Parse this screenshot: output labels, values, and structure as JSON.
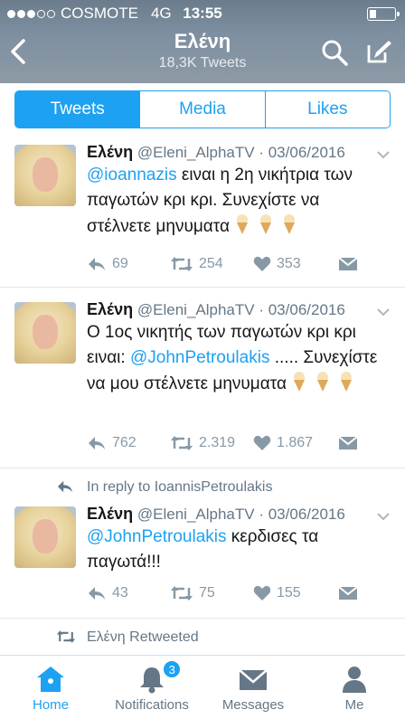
{
  "status_bar": {
    "carrier": "COSMOTE",
    "network": "4G",
    "time": "13:55",
    "signal_dots_filled": 3,
    "signal_dots_total": 5,
    "battery_level": 0.2
  },
  "header": {
    "title": "Ελένη",
    "subtitle": "18,3K Tweets",
    "back_icon": "chevron-left-icon",
    "search_icon": "search-icon",
    "compose_icon": "compose-icon"
  },
  "tabs": {
    "items": [
      {
        "label": "Tweets",
        "active": true
      },
      {
        "label": "Media",
        "active": false
      },
      {
        "label": "Likes",
        "active": false
      }
    ]
  },
  "tweets": [
    {
      "name": "Ελένη",
      "handle": "@Eleni_AlphaTV",
      "date": "· 03/06/2016",
      "mention_1": "@ioannazis",
      "text_1": " ειναι η 2η νικήτρια των παγωτών κρι κρι. Συνεχίστε να στέλνετε μηνυματα ",
      "reply_count": "69",
      "retweet_count": "254",
      "like_count": "353"
    },
    {
      "name": "Ελένη",
      "handle": "@Eleni_AlphaTV",
      "date": "· 03/06/2016",
      "text_pre": "Ο 1ος νικητής των παγωτών κρι κρι ειναι: ",
      "mention_1": "@JohnPetroulakis",
      "text_1": " ..... Συνεχίστε να μου στέλνετε μηνυματα ",
      "reply_count": "762",
      "retweet_count": "2.319",
      "like_count": "1.867"
    },
    {
      "context": "In reply to IoannisPetroulakis",
      "name": "Ελένη",
      "handle": "@Eleni_AlphaTV",
      "date": "· 03/06/2016",
      "mention_1": "@JohnPetroulakis",
      "text_1": " κερδισες τα παγωτά!!!",
      "reply_count": "43",
      "retweet_count": "75",
      "like_count": "155"
    }
  ],
  "retweet_context": "Ελένη Retweeted",
  "tabbar": {
    "items": [
      {
        "label": "Home",
        "icon": "home-icon",
        "active": true
      },
      {
        "label": "Notifications",
        "icon": "bell-icon",
        "badge": "3"
      },
      {
        "label": "Messages",
        "icon": "envelope-icon"
      },
      {
        "label": "Me",
        "icon": "person-icon"
      }
    ]
  },
  "colors": {
    "accent": "#1da1f2",
    "muted": "#8899a6"
  }
}
